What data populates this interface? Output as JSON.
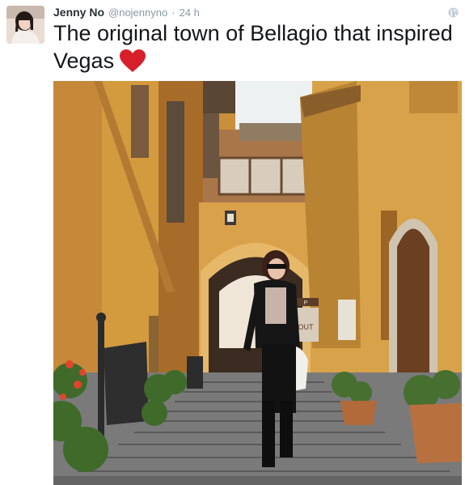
{
  "tweet": {
    "author_name": "Jenny No",
    "handle": "@nojennyno",
    "separator": "·",
    "time": "24 h",
    "text": "The original town of Bellagio that inspired Vegas",
    "emoji": "red-heart-icon",
    "visibility_icon": "globe-icon"
  },
  "photo": {
    "signs": [
      "P",
      "OUT"
    ]
  },
  "colors": {
    "wall_ochre": "#d39a3e",
    "wall_shadow": "#9c6525",
    "stone_step": "#6e6e6e",
    "heart_red": "#d61f2a",
    "muted_text": "#8899a6"
  }
}
